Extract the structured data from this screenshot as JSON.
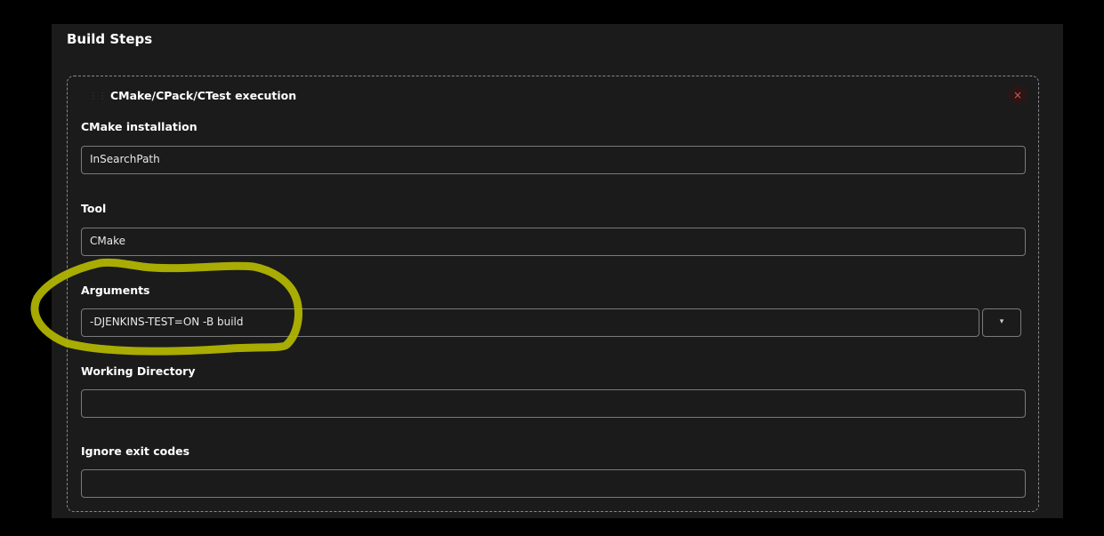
{
  "section": {
    "title": "Build Steps"
  },
  "step": {
    "title": "CMake/CPack/CTest execution",
    "close_symbol": "×",
    "fields": {
      "cmake_installation": {
        "label": "CMake installation",
        "value": "InSearchPath"
      },
      "tool": {
        "label": "Tool",
        "value": "CMake"
      },
      "arguments": {
        "label": "Arguments",
        "value": "-DJENKINS-TEST=ON -B build",
        "dropdown_symbol": "▾"
      },
      "working_directory": {
        "label": "Working Directory",
        "value": ""
      },
      "ignore_exit_codes": {
        "label": "Ignore exit codes",
        "value": ""
      }
    }
  },
  "annotation": {
    "color": "#b5b800"
  }
}
